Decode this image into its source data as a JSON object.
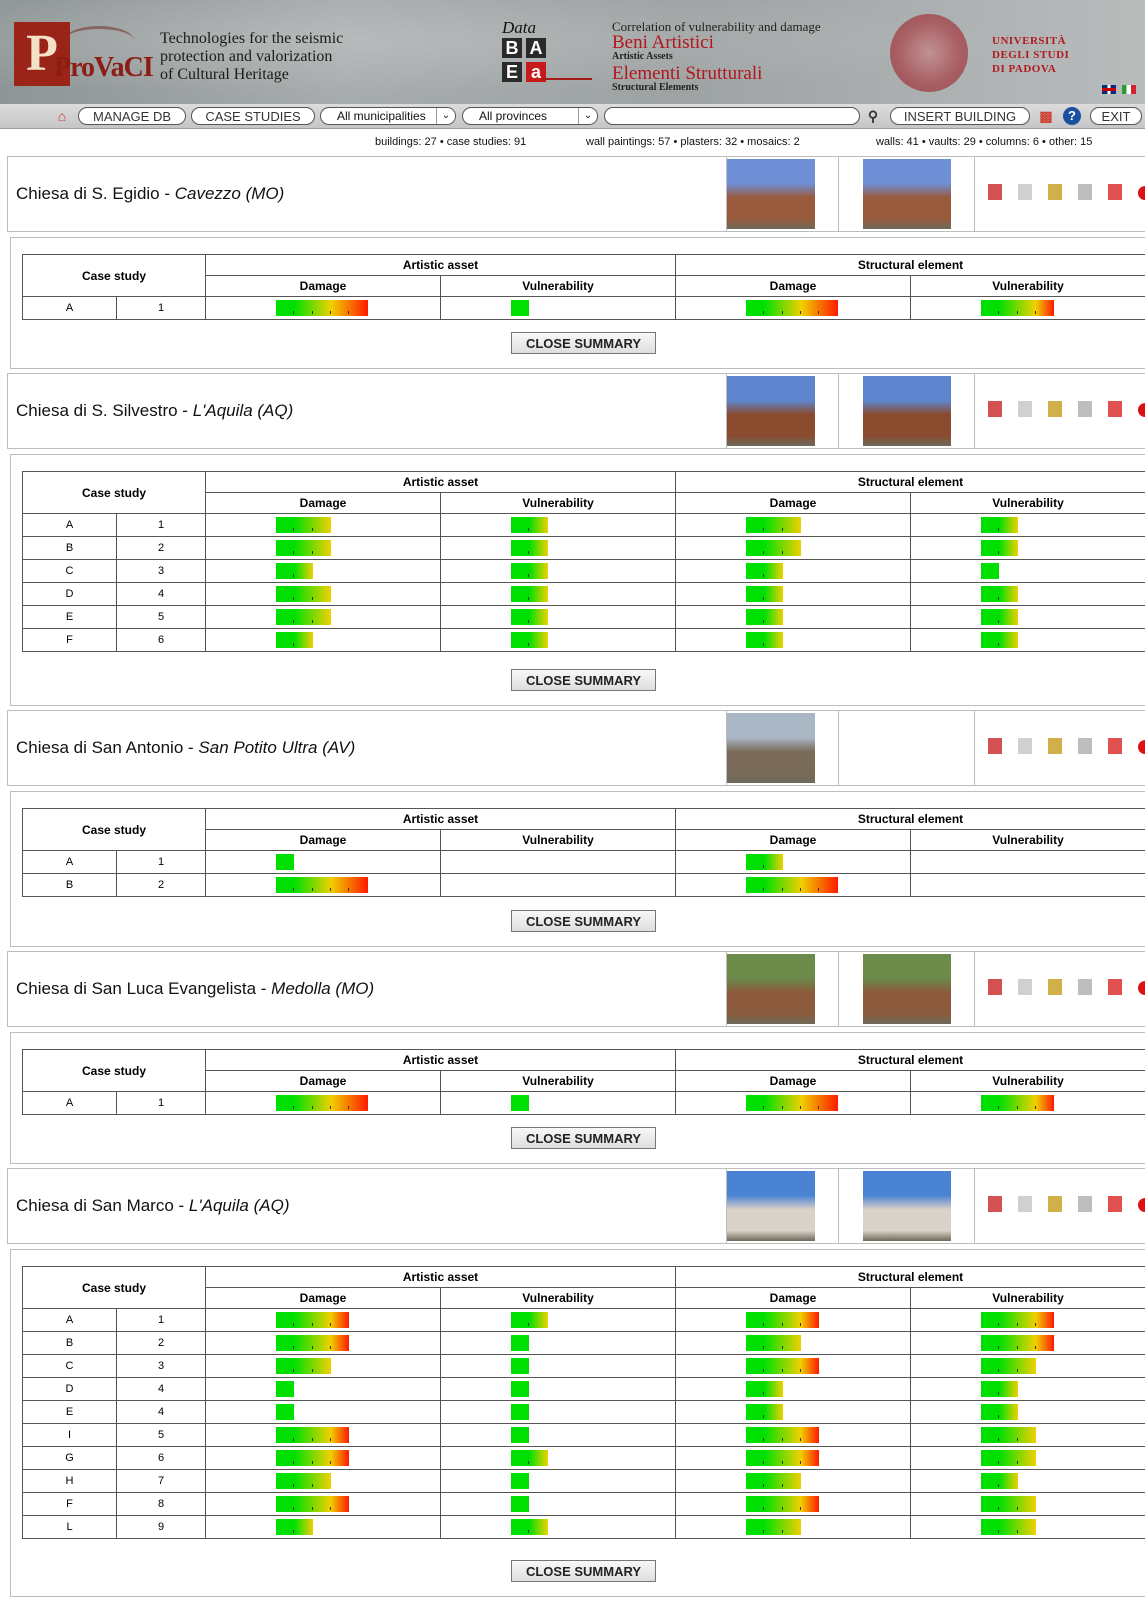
{
  "header": {
    "logo_text": "ProVaCI",
    "tagline": [
      "Technologies for the seismic",
      "protection and valorization",
      "of Cultural Heritage"
    ],
    "db_logo": {
      "data": "Data",
      "cells": [
        "B",
        "A",
        "E",
        "a"
      ]
    },
    "correlation": "Correlation of vulnerability and damage",
    "beni": "Beni Artistici",
    "artistic_assets": "Artistic Assets",
    "elementi": "Elementi Strutturali",
    "structural_elements": "Structural Elements",
    "university": [
      "UNIVERSITÀ",
      "DEGLI STUDI",
      "DI PADOVA"
    ]
  },
  "toolbar": {
    "manage_db": "MANAGE DB",
    "case_studies": "CASE STUDIES",
    "municipalities": "All municipalities",
    "provinces": "All provinces",
    "search_value": "",
    "insert_building": "INSERT BUILDING",
    "exit": "EXIT"
  },
  "stats": {
    "buildings": "buildings: 27 • case studies: 91",
    "art": "wall paintings: 57 • plasters: 32 • mosaics: 2",
    "struct": "walls: 41 • vaults: 29 • columns: 6 • other: 15"
  },
  "labels": {
    "case_study": "Case study",
    "artistic_asset": "Artistic asset",
    "structural_element": "Structural element",
    "damage": "Damage",
    "vulnerability": "Vulnerability",
    "close_summary": "CLOSE SUMMARY"
  },
  "colors": {
    "bar_start": "#00e000",
    "bar_mid": "#f0d000",
    "bar_end": "#ff1a00"
  },
  "buildings": [
    {
      "name": "Chiesa di S. Egidio",
      "location": "Cavezzo (MO)",
      "photos": 2,
      "rows": [
        {
          "letter": "A",
          "num": "1",
          "ad": 5,
          "av": 1,
          "sd": 5,
          "sv": 4
        }
      ]
    },
    {
      "name": "Chiesa di S. Silvestro",
      "location": "L'Aquila (AQ)",
      "photos": 2,
      "rows": [
        {
          "letter": "A",
          "num": "1",
          "ad": 3,
          "av": 2,
          "sd": 3,
          "sv": 2
        },
        {
          "letter": "B",
          "num": "2",
          "ad": 3,
          "av": 2,
          "sd": 3,
          "sv": 2
        },
        {
          "letter": "C",
          "num": "3",
          "ad": 2,
          "av": 2,
          "sd": 2,
          "sv": 1
        },
        {
          "letter": "D",
          "num": "4",
          "ad": 3,
          "av": 2,
          "sd": 2,
          "sv": 2
        },
        {
          "letter": "E",
          "num": "5",
          "ad": 3,
          "av": 2,
          "sd": 2,
          "sv": 2
        },
        {
          "letter": "F",
          "num": "6",
          "ad": 2,
          "av": 2,
          "sd": 2,
          "sv": 2
        }
      ]
    },
    {
      "name": "Chiesa di San Antonio",
      "location": "San Potito Ultra (AV)",
      "photos": 1,
      "rows": [
        {
          "letter": "A",
          "num": "1",
          "ad": 1,
          "av": 0,
          "sd": 2,
          "sv": 0
        },
        {
          "letter": "B",
          "num": "2",
          "ad": 5,
          "av": 0,
          "sd": 5,
          "sv": 0
        }
      ]
    },
    {
      "name": "Chiesa di San Luca Evangelista",
      "location": "Medolla (MO)",
      "photos": 2,
      "rows": [
        {
          "letter": "A",
          "num": "1",
          "ad": 5,
          "av": 1,
          "sd": 5,
          "sv": 4
        }
      ]
    },
    {
      "name": "Chiesa di San Marco",
      "location": "L'Aquila (AQ)",
      "photos": 2,
      "rows": [
        {
          "letter": "A",
          "num": "1",
          "ad": 4,
          "av": 2,
          "sd": 4,
          "sv": 4
        },
        {
          "letter": "B",
          "num": "2",
          "ad": 4,
          "av": 1,
          "sd": 3,
          "sv": 4
        },
        {
          "letter": "C",
          "num": "3",
          "ad": 3,
          "av": 1,
          "sd": 4,
          "sv": 3
        },
        {
          "letter": "D",
          "num": "4",
          "ad": 1,
          "av": 1,
          "sd": 2,
          "sv": 2
        },
        {
          "letter": "E",
          "num": "4",
          "ad": 1,
          "av": 1,
          "sd": 2,
          "sv": 2
        },
        {
          "letter": "I",
          "num": "5",
          "ad": 4,
          "av": 1,
          "sd": 4,
          "sv": 3
        },
        {
          "letter": "G",
          "num": "6",
          "ad": 4,
          "av": 2,
          "sd": 4,
          "sv": 3
        },
        {
          "letter": "H",
          "num": "7",
          "ad": 3,
          "av": 1,
          "sd": 3,
          "sv": 2
        },
        {
          "letter": "F",
          "num": "8",
          "ad": 4,
          "av": 1,
          "sd": 4,
          "sv": 3
        },
        {
          "letter": "L",
          "num": "9",
          "ad": 2,
          "av": 2,
          "sd": 3,
          "sv": 3
        }
      ]
    }
  ]
}
